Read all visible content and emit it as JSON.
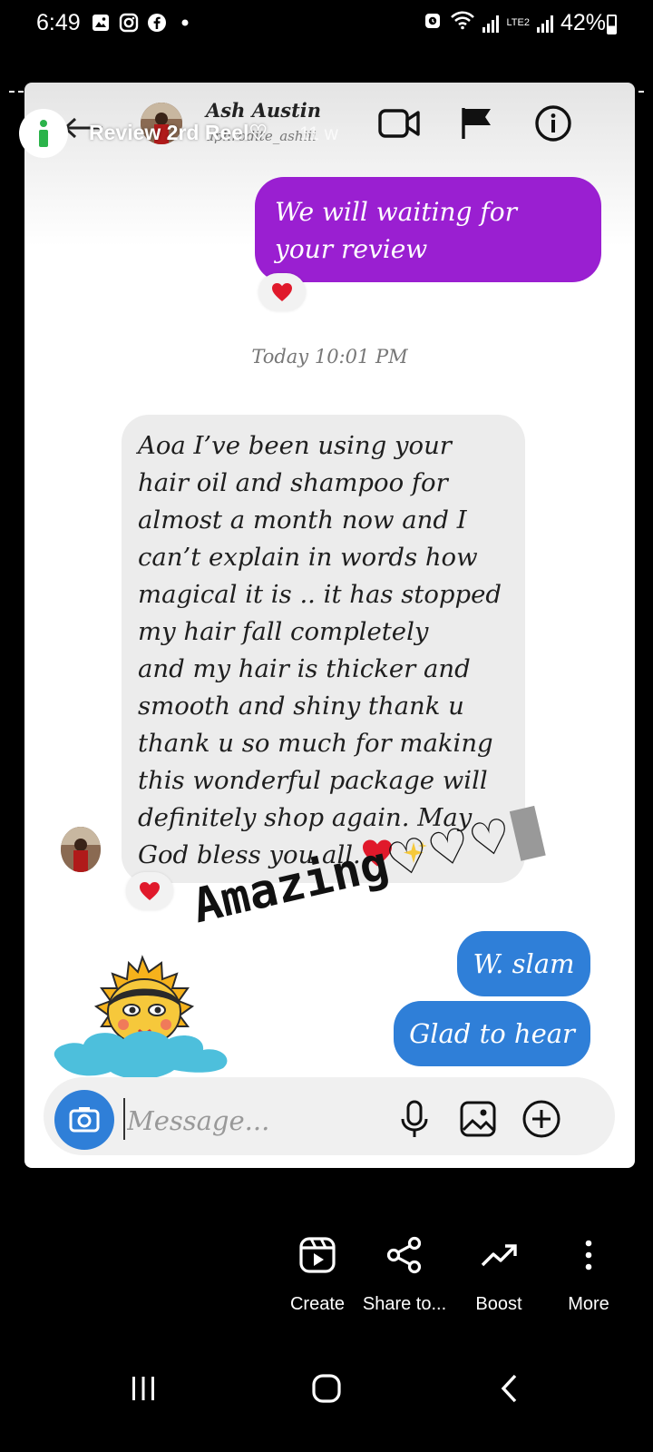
{
  "status_bar": {
    "time": "6:49",
    "battery_percent": "42%",
    "network": "LTE2"
  },
  "story": {
    "title": "Review 2rd Reel♡",
    "age": "11 w"
  },
  "chat_header": {
    "name": "Ash Austin",
    "handle": "aphrodite_ashiii"
  },
  "messages": {
    "outgoing_purple": "We will waiting for your review",
    "timestamp": "Today 10:01 PM",
    "incoming_lines": [
      "Aoa I’ve been using your",
      "hair oil and shampoo for",
      "almost a month now and I",
      "can’t explain in words how",
      "magical it is .. it has stopped",
      "my hair fall completely",
      "and my hair is thicker and",
      "smooth and shiny thank u",
      "thank u so much for making",
      "this wonderful package will",
      "definitely shop again. May",
      "God bless you all."
    ],
    "outgoing_blue_1": "W. slam",
    "outgoing_blue_2": "Glad to hear"
  },
  "sticker": {
    "text": "Amazing",
    "hearts": "♡♡♡"
  },
  "composer": {
    "placeholder": "Message..."
  },
  "actions": [
    {
      "label": "Create",
      "icon": "reels-icon"
    },
    {
      "label": "Share to...",
      "icon": "share-icon"
    },
    {
      "label": "Boost",
      "icon": "trending-up-icon"
    },
    {
      "label": "More",
      "icon": "more-vertical-icon"
    }
  ],
  "colors": {
    "purple_bubble": "#9a1fd1",
    "blue_bubble": "#2f7fd8",
    "heart": "#e0192b",
    "story_badge": "#2bb34a"
  }
}
